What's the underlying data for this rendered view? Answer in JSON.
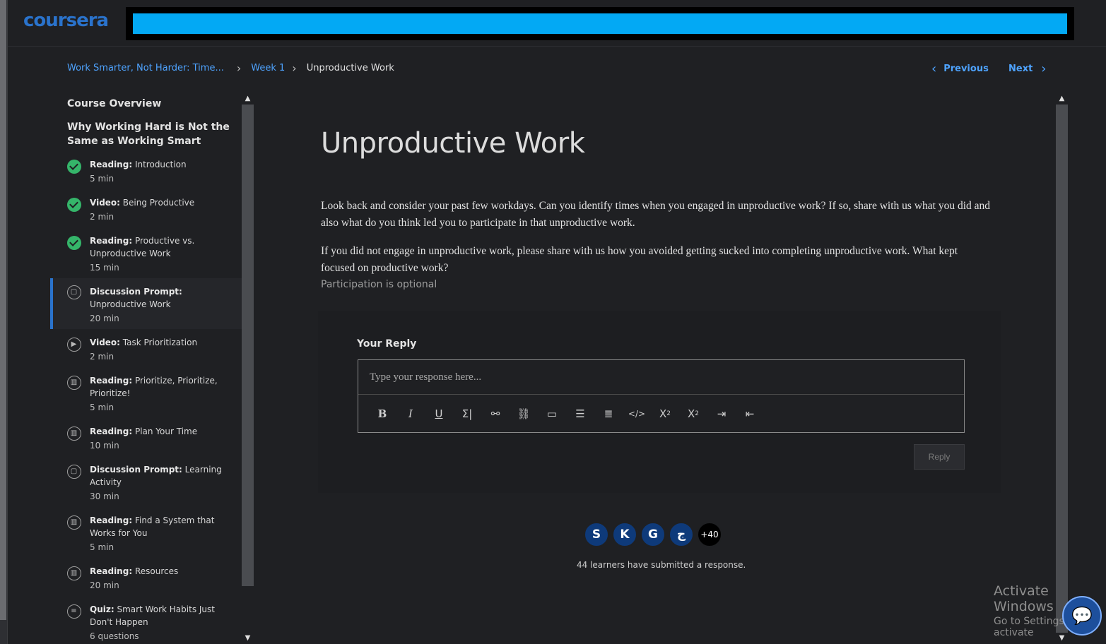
{
  "brand": {
    "logo_text": "coursera"
  },
  "search": {
    "value": ""
  },
  "breadcrumb": {
    "course": "Work Smarter, Not Harder: Time...",
    "week": "Week 1",
    "current": "Unproductive Work"
  },
  "pager": {
    "previous": "Previous",
    "next": "Next"
  },
  "sidebar": {
    "title": "Course Overview",
    "module": "Why Working Hard is Not the Same as Working Smart",
    "items": [
      {
        "type": "Reading:",
        "title": "Introduction",
        "duration": "5 min",
        "status": "completed",
        "icon": "check-icon"
      },
      {
        "type": "Video:",
        "title": "Being Productive",
        "duration": "2 min",
        "status": "completed",
        "icon": "check-icon"
      },
      {
        "type": "Reading:",
        "title": "Productive vs. Unproductive Work",
        "duration": "15 min",
        "status": "completed",
        "icon": "check-icon"
      },
      {
        "type": "Discussion Prompt:",
        "title": "Unproductive Work",
        "duration": "20 min",
        "status": "current",
        "icon": "discussion-icon"
      },
      {
        "type": "Video:",
        "title": "Task Prioritization",
        "duration": "2 min",
        "status": "pending",
        "icon": "play-icon"
      },
      {
        "type": "Reading:",
        "title": "Prioritize, Prioritize, Prioritize!",
        "duration": "5 min",
        "status": "pending",
        "icon": "book-icon"
      },
      {
        "type": "Reading:",
        "title": "Plan Your Time",
        "duration": "10 min",
        "status": "pending",
        "icon": "book-icon"
      },
      {
        "type": "Discussion Prompt:",
        "title": "Learning Activity",
        "duration": "30 min",
        "status": "pending",
        "icon": "discussion-icon"
      },
      {
        "type": "Reading:",
        "title": "Find a System that Works for You",
        "duration": "5 min",
        "status": "pending",
        "icon": "book-icon"
      },
      {
        "type": "Reading:",
        "title": "Resources",
        "duration": "20 min",
        "status": "pending",
        "icon": "book-icon"
      },
      {
        "type": "Quiz:",
        "title": "Smart Work Habits Just Don't Happen",
        "duration": "6 questions",
        "status": "pending",
        "icon": "quiz-icon"
      }
    ]
  },
  "main": {
    "title": "Unproductive Work",
    "paragraph1": "Look back and consider your past few workdays. Can you identify times when you engaged in unproductive work? If so, share with us what you did and also what do you think led you to participate in that unproductive work.",
    "paragraph2": "If you did not engage in unproductive work, please share with us how you avoided getting sucked into completing unproductive work. What kept focused on productive work?",
    "optional_note": "Participation is optional"
  },
  "reply": {
    "label": "Your Reply",
    "placeholder": "Type your response here...",
    "button": "Reply",
    "toolbar": [
      "B",
      "I",
      "U",
      "Σ",
      "link",
      "unlink",
      "image",
      "bulleted-list",
      "numbered-list",
      "code",
      "subscript",
      "superscript",
      "indent",
      "outdent"
    ]
  },
  "submissions": {
    "avatars": [
      "S",
      "K",
      "G",
      "ج"
    ],
    "more": "+40",
    "text": "44 learners have submitted a response."
  },
  "watermark": {
    "line1": "Activate Windows",
    "line2": "Go to Settings to activate"
  },
  "colors": {
    "accent": "#2a73cc",
    "link": "#4ea3ff",
    "background": "#1f2023",
    "success": "#35b56a",
    "search_bar": "#03a9f4"
  }
}
